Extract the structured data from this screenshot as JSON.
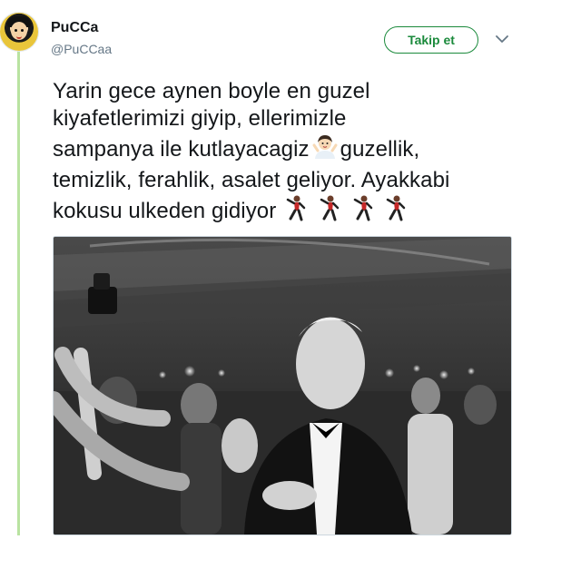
{
  "tweet": {
    "author": {
      "display_name": "PuCCa",
      "handle": "@PuCCaa",
      "avatar_icon": "cartoon-girl-avatar"
    },
    "follow_button_label": "Takip et",
    "menu_icon": "chevron-down-icon",
    "text_lines": [
      "Yarin gece aynen boyle en guzel",
      "kiyafetlerimizi giyip, ellerimizle",
      "sampanya ile kutlayacagiz",
      "guzellik,",
      "temizlik, ferahlik, asalet geliyor. Ayakkabi",
      "kokusu ulkeden gidiyor"
    ],
    "emojis": {
      "line3": "woman-gesturing-ok-emoji",
      "line6": [
        "man-dancing-emoji",
        "man-dancing-emoji",
        "man-dancing-emoji",
        "man-dancing-emoji"
      ]
    },
    "media_description_icon": "photo-black-white-party"
  },
  "colors": {
    "thread_line": "#b9e3a1",
    "follow_accent": "#1b8a3c",
    "text": "#14171a",
    "muted": "#657786"
  }
}
